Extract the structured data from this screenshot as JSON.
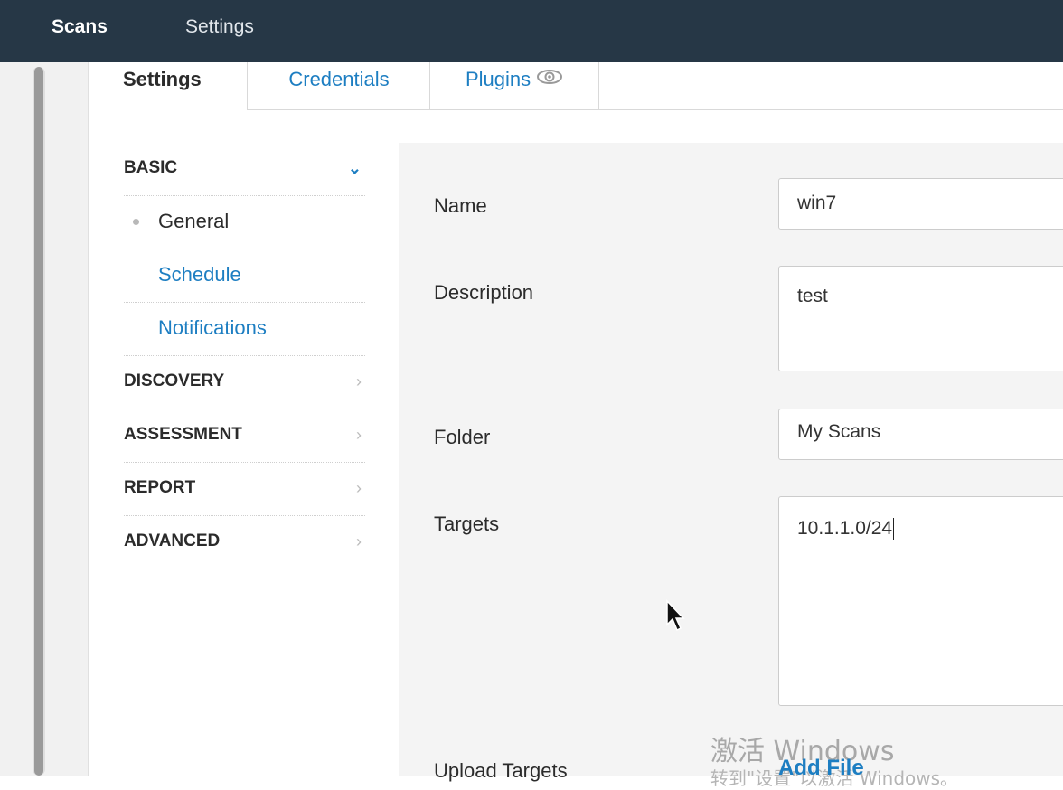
{
  "topnav": {
    "scans": "Scans",
    "settings": "Settings"
  },
  "tabs": {
    "settings": "Settings",
    "credentials": "Credentials",
    "plugins": "Plugins"
  },
  "menu": {
    "basic": "BASIC",
    "general": "General",
    "schedule": "Schedule",
    "notifications": "Notifications",
    "discovery": "DISCOVERY",
    "assessment": "ASSESSMENT",
    "report": "REPORT",
    "advanced": "ADVANCED",
    "chevron_open": "⌄",
    "chevron_closed": "›"
  },
  "form": {
    "name_label": "Name",
    "name_value": "win7",
    "description_label": "Description",
    "description_value": "test",
    "folder_label": "Folder",
    "folder_value": "My Scans",
    "targets_label": "Targets",
    "targets_value": "10.1.1.0/24",
    "upload_label": "Upload Targets",
    "add_file": "Add File"
  },
  "watermark": {
    "line1": "激活 Windows",
    "line2": "转到\"设置\"以激活 Windows。"
  },
  "colors": {
    "topbar": "#263746",
    "accent": "#1d7ec2",
    "panel": "#f4f4f4"
  },
  "icons": {
    "plugins_eye": "eye-icon",
    "pointer": "mouse-cursor-icon"
  }
}
